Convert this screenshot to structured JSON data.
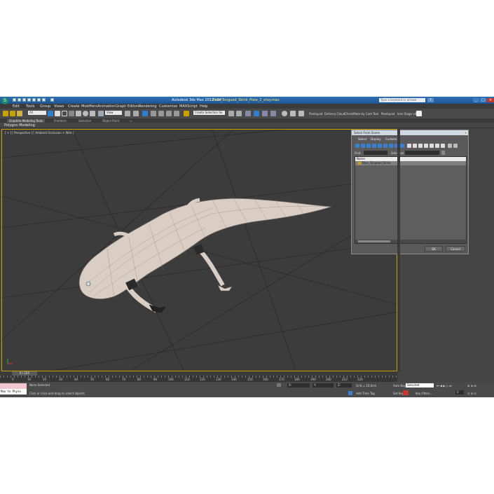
{
  "window": {
    "title": "Autodesk 3ds Max 2012 x64",
    "file": "Blue_Tongued_Skink_Pose_2_vray.max",
    "search_placeholder": "Type a keyword or phrase",
    "accent": "#1d5596"
  },
  "menu": [
    "Edit",
    "Tools",
    "Group",
    "Views",
    "Create",
    "Modifiers",
    "Animation",
    "Graph Editors",
    "Rendering",
    "Customize",
    "MAXScript",
    "Help"
  ],
  "toolbar": {
    "filter_value": "All",
    "view_value": "View",
    "selection_set": "Create Selection Se",
    "extras": [
      "Pixelquad",
      "Delivery Cloud",
      "CheckMate",
      "zly Cam Tool",
      "Pixelquad",
      "lens Stage v4"
    ]
  },
  "ribbon": {
    "tabs": [
      "Graphite Modeling Tools",
      "Freeform",
      "Selection",
      "Object Paint"
    ],
    "panel": "Polygon Modeling"
  },
  "viewport": {
    "label": "[ + ] [ Perspective ] [ Ambient Occlusion + Wire ]",
    "border_color": "#c9a100"
  },
  "timeline": {
    "frame": "0 / 225",
    "ticks": [
      "0",
      "10",
      "20",
      "30",
      "40",
      "50",
      "60",
      "70",
      "80",
      "90",
      "100",
      "110",
      "120",
      "130",
      "140",
      "150",
      "160",
      "170",
      "180",
      "190",
      "200",
      "210",
      "220"
    ]
  },
  "status": {
    "maxscript_text": "Max to Physx",
    "selection": "None Selected",
    "prompt": "Click or click-and-drag to select objects",
    "grid": "Grid = 10,0cm",
    "add_time_tag": "Add Time Tag",
    "auto_key": "Auto Key",
    "set_key": "Set Key",
    "key_mode": "Selected",
    "key_filters": "Key Filters..."
  },
  "dialog": {
    "title": "Select From Scene",
    "menu": [
      "Select",
      "Display",
      "Customize"
    ],
    "find_label": "Find:",
    "selection_set_label": "Selection Set:",
    "column_header": "Name",
    "items": [
      "Blue_Tongued_Skink"
    ],
    "ok": "OK",
    "cancel": "Cancel"
  }
}
